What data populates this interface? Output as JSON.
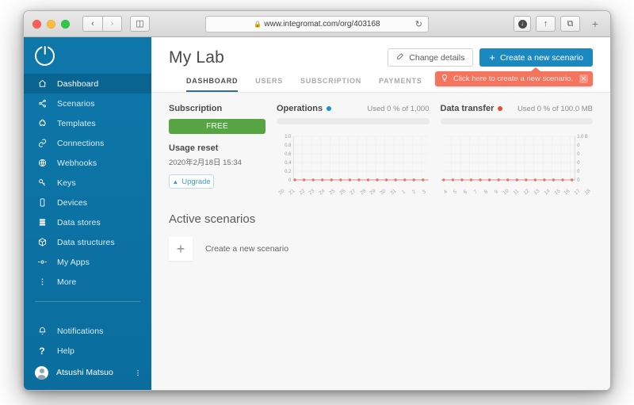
{
  "browser": {
    "url": "www.integromat.com/org/403168",
    "lock_icon": "lock-icon",
    "back_label": "‹",
    "forward_label": "›",
    "sidebar_toggle_label": "◫",
    "reload_label": "↻",
    "share_label": "↑",
    "tabs_label": "⧉",
    "new_tab_label": "+"
  },
  "sidebar": {
    "logo_name": "integromat-logo",
    "items": [
      {
        "label": "Dashboard",
        "icon": "home-icon",
        "active": true
      },
      {
        "label": "Scenarios",
        "icon": "share-nodes-icon",
        "active": false
      },
      {
        "label": "Templates",
        "icon": "puzzle-icon",
        "active": false
      },
      {
        "label": "Connections",
        "icon": "link-icon",
        "active": false
      },
      {
        "label": "Webhooks",
        "icon": "globe-icon",
        "active": false
      },
      {
        "label": "Keys",
        "icon": "key-icon",
        "active": false
      },
      {
        "label": "Devices",
        "icon": "device-icon",
        "active": false
      },
      {
        "label": "Data stores",
        "icon": "database-icon",
        "active": false
      },
      {
        "label": "Data structures",
        "icon": "cube-icon",
        "active": false
      },
      {
        "label": "My Apps",
        "icon": "node-icon",
        "active": false
      },
      {
        "label": "More",
        "icon": "dots-vertical-icon",
        "active": false
      }
    ],
    "bottom_items": [
      {
        "label": "Notifications",
        "icon": "bell-icon"
      },
      {
        "label": "Help",
        "icon": "question-icon"
      }
    ],
    "user": {
      "name": "Atsushi Matsuo",
      "avatar_icon": "avatar-icon",
      "menu_icon": "dots-vertical-icon"
    }
  },
  "header": {
    "title": "My Lab",
    "change_details_label": "Change details",
    "change_details_icon": "edit-icon",
    "create_scenario_label": "Create a new scenario",
    "create_scenario_plus": "+",
    "tooltip": {
      "icon": "lightbulb-icon",
      "text": "Click here to create a new scenario.",
      "close_label": "✕",
      "color": "#f4745e"
    },
    "tabs": [
      {
        "label": "DASHBOARD",
        "active": true
      },
      {
        "label": "USERS",
        "active": false
      },
      {
        "label": "SUBSCRIPTION",
        "active": false
      },
      {
        "label": "PAYMENTS",
        "active": false
      }
    ]
  },
  "subscription": {
    "title": "Subscription",
    "plan_badge": "FREE",
    "plan_color": "#57a443",
    "usage_reset_title": "Usage reset",
    "usage_reset_value": "2020年2月18日 15:34",
    "upgrade_label": "Upgrade",
    "upgrade_icon": "caret-up-icon"
  },
  "operations": {
    "title": "Operations",
    "dot_color": "#1e90c8",
    "usage_text": "Used 0 % of 1,000",
    "progress_percent": 0
  },
  "data_transfer": {
    "title": "Data transfer",
    "dot_color": "#ea4b36",
    "usage_text": "Used 0 % of 100.0 MB",
    "progress_percent": 0
  },
  "active_scenarios": {
    "title": "Active scenarios",
    "create_tile_icon": "plus-icon",
    "create_label": "Create a new scenario"
  },
  "chart_data": [
    {
      "type": "line",
      "title": "Operations",
      "xlabel": "",
      "ylabel": "",
      "ylim": [
        0,
        1.0
      ],
      "yticks": [
        "0",
        "0.2",
        "0.4",
        "0.6",
        "0.8",
        "1.0"
      ],
      "grid": true,
      "legend": "none",
      "line_color": "#ea6a5a",
      "marker_color": "#ea6a5a",
      "categories": [
        "20",
        "21",
        "22",
        "23",
        "24",
        "25",
        "26",
        "27",
        "28",
        "29",
        "30",
        "31",
        "1",
        "2",
        "3"
      ],
      "values": [
        0,
        0,
        0,
        0,
        0,
        0,
        0,
        0,
        0,
        0,
        0,
        0,
        0,
        0,
        0
      ]
    },
    {
      "type": "line",
      "title": "Data transfer",
      "xlabel": "",
      "ylabel": "",
      "ylim": [
        0,
        1.0
      ],
      "yticks": [
        "0",
        "0",
        "0",
        "0",
        "0",
        "1.0 B"
      ],
      "yaxis_position": "right",
      "grid": true,
      "legend": "none",
      "line_color": "#ea6a5a",
      "marker_color": "#ea6a5a",
      "categories": [
        "4",
        "5",
        "6",
        "7",
        "8",
        "9",
        "10",
        "11",
        "12",
        "13",
        "14",
        "15",
        "16",
        "17",
        "18"
      ],
      "values": [
        0,
        0,
        0,
        0,
        0,
        0,
        0,
        0,
        0,
        0,
        0,
        0,
        0,
        0,
        0
      ]
    }
  ]
}
